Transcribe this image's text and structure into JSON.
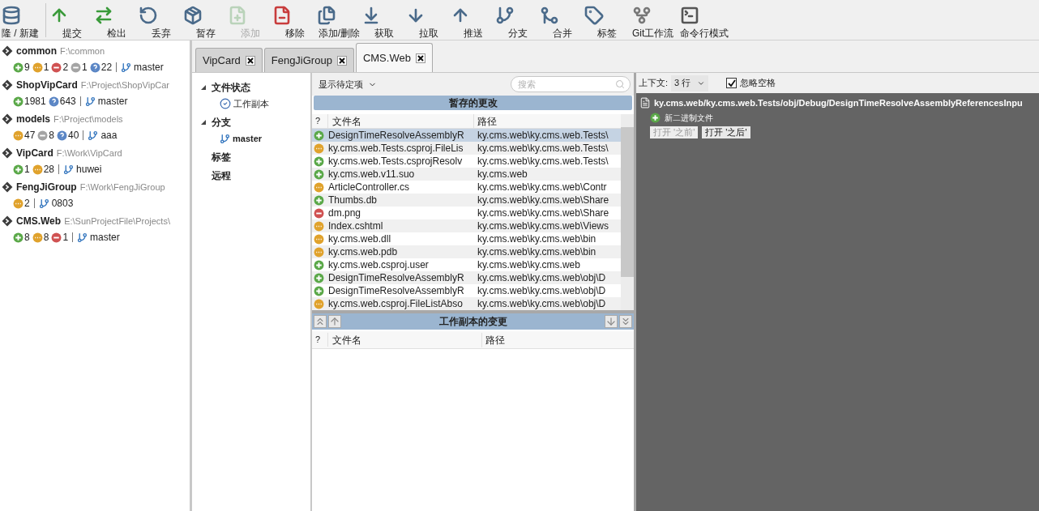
{
  "toolbar": [
    {
      "label": "隆 / 新建",
      "disabled": false
    },
    {
      "label": "提交",
      "disabled": false
    },
    {
      "label": "检出",
      "disabled": false
    },
    {
      "label": "丢弃",
      "disabled": false
    },
    {
      "label": "暂存",
      "disabled": false
    },
    {
      "label": "添加",
      "disabled": true
    },
    {
      "label": "移除",
      "disabled": false
    },
    {
      "label": "添加/删除",
      "disabled": false
    },
    {
      "label": "获取",
      "disabled": false
    },
    {
      "label": "拉取",
      "disabled": false
    },
    {
      "label": "推送",
      "disabled": false
    },
    {
      "label": "分支",
      "disabled": false
    },
    {
      "label": "合并",
      "disabled": false
    },
    {
      "label": "标签",
      "disabled": false
    },
    {
      "label": "Git工作流",
      "disabled": false
    },
    {
      "label": "命令行模式",
      "disabled": false
    }
  ],
  "sidebar": {
    "repositories": [
      {
        "name": "common",
        "path": "F:\\common",
        "counts": [
          {
            "kind": "added",
            "count": "9"
          },
          {
            "kind": "modified",
            "count": "1"
          },
          {
            "kind": "removed",
            "count": "2"
          },
          {
            "kind": "missing",
            "count": "1"
          },
          {
            "kind": "untracked",
            "count": "22"
          }
        ],
        "branch": "master"
      },
      {
        "name": "ShopVipCard",
        "path": "F:\\Project\\ShopVipCar",
        "counts": [
          {
            "kind": "added",
            "count": "1981"
          },
          {
            "kind": "untracked",
            "count": "643"
          }
        ],
        "branch": "master"
      },
      {
        "name": "models",
        "path": "F:\\Project\\models",
        "counts": [
          {
            "kind": "modified",
            "count": "47"
          },
          {
            "kind": "missing",
            "count": "8"
          },
          {
            "kind": "untracked",
            "count": "40"
          }
        ],
        "branch": "aaa"
      },
      {
        "name": "VipCard",
        "path": "F:\\Work\\VipCard",
        "counts": [
          {
            "kind": "added",
            "count": "1"
          },
          {
            "kind": "modified",
            "count": "28"
          }
        ],
        "branch": "huwei"
      },
      {
        "name": "FengJiGroup",
        "path": "F:\\Work\\FengJiGroup",
        "counts": [
          {
            "kind": "modified",
            "count": "2"
          }
        ],
        "branch": "0803"
      },
      {
        "name": "CMS.Web",
        "path": "E:\\SunProjectFile\\Projects\\",
        "counts": [
          {
            "kind": "added",
            "count": "8"
          },
          {
            "kind": "modified",
            "count": "8"
          },
          {
            "kind": "removed",
            "count": "1"
          }
        ],
        "branch": "master"
      }
    ]
  },
  "tabs": [
    {
      "label": "VipCard",
      "selected": false
    },
    {
      "label": "FengJiGroup",
      "selected": false
    },
    {
      "label": "CMS.Web",
      "selected": true
    }
  ],
  "nav": [
    {
      "label": "文件状态",
      "expanded": true,
      "children": [
        {
          "label": "工作副本",
          "kind": "working-copy"
        }
      ]
    },
    {
      "label": "分支",
      "expanded": true,
      "children": [
        {
          "label": "master",
          "kind": "branch"
        }
      ]
    },
    {
      "label": "标签"
    },
    {
      "label": "远程"
    }
  ],
  "files": {
    "filter": "显示待定项",
    "search": {
      "placeholder": "搜索"
    },
    "staged": {
      "title": "暂存的更改",
      "columns": [
        "?",
        "文件名",
        "路径"
      ],
      "rows": [
        {
          "kind": "added",
          "name": "DesignTimeResolveAssemblyR",
          "path": "ky.cms.web\\ky.cms.web.Tests\\",
          "selected": true
        },
        {
          "kind": "modified",
          "name": "ky.cms.web.Tests.csproj.FileLis",
          "path": "ky.cms.web\\ky.cms.web.Tests\\",
          "selected": false
        },
        {
          "kind": "added",
          "name": "ky.cms.web.Tests.csprojResolv",
          "path": "ky.cms.web\\ky.cms.web.Tests\\",
          "selected": false
        },
        {
          "kind": "added",
          "name": "ky.cms.web.v11.suo",
          "path": "ky.cms.web",
          "selected": false
        },
        {
          "kind": "modified",
          "name": "ArticleController.cs",
          "path": "ky.cms.web\\ky.cms.web\\Contr",
          "selected": false
        },
        {
          "kind": "added",
          "name": "Thumbs.db",
          "path": "ky.cms.web\\ky.cms.web\\Share",
          "selected": false
        },
        {
          "kind": "removed",
          "name": "dm.png",
          "path": "ky.cms.web\\ky.cms.web\\Share",
          "selected": false
        },
        {
          "kind": "modified",
          "name": "Index.cshtml",
          "path": "ky.cms.web\\ky.cms.web\\Views",
          "selected": false
        },
        {
          "kind": "modified",
          "name": "ky.cms.web.dll",
          "path": "ky.cms.web\\ky.cms.web\\bin",
          "selected": false
        },
        {
          "kind": "modified",
          "name": "ky.cms.web.pdb",
          "path": "ky.cms.web\\ky.cms.web\\bin",
          "selected": false
        },
        {
          "kind": "added",
          "name": "ky.cms.web.csproj.user",
          "path": "ky.cms.web\\ky.cms.web",
          "selected": false
        },
        {
          "kind": "added",
          "name": "DesignTimeResolveAssemblyR",
          "path": "ky.cms.web\\ky.cms.web\\obj\\D",
          "selected": false
        },
        {
          "kind": "added",
          "name": "DesignTimeResolveAssemblyR",
          "path": "ky.cms.web\\ky.cms.web\\obj\\D",
          "selected": false
        },
        {
          "kind": "modified",
          "name": "ky.cms.web.csproj.FileListAbso",
          "path": "ky.cms.web\\ky.cms.web\\obj\\D",
          "selected": false
        }
      ]
    },
    "working": {
      "title": "工作副本的变更",
      "columns": [
        "?",
        "文件名",
        "路径"
      ]
    }
  },
  "diff": {
    "context_label": "上下文:",
    "context_value": "3 行",
    "ignore_whitespace": {
      "label": "忽略空格",
      "checked": true
    },
    "file": {
      "path": "ky.cms.web/ky.cms.web.Tests/obj/Debug/DesignTimeResolveAssemblyReferencesInpu",
      "kind": "added",
      "note": "新二进制文件"
    },
    "buttons": [
      {
        "label": "打开 '之前'",
        "disabled": true
      },
      {
        "label": "打开 '之后'",
        "disabled": false
      }
    ]
  }
}
